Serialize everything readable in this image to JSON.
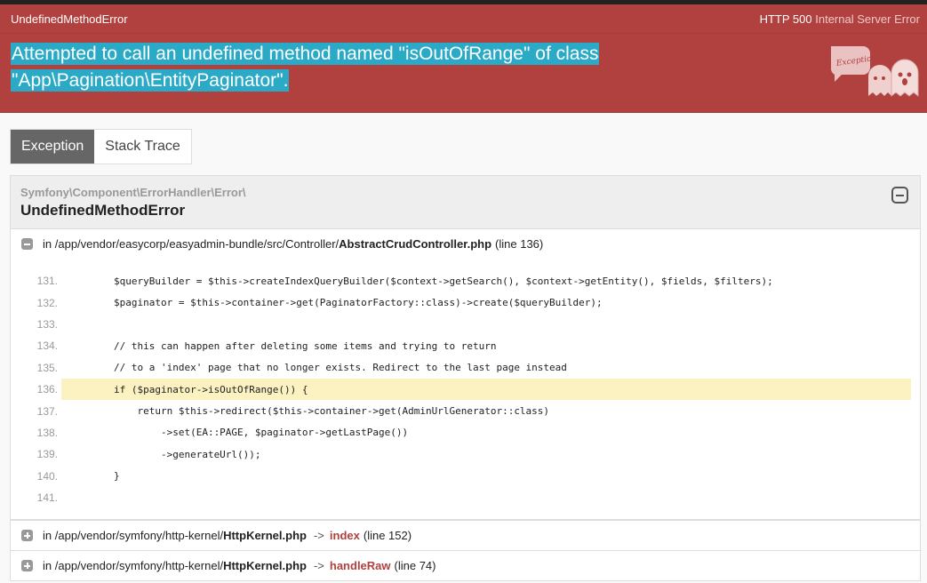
{
  "header": {
    "exception_name": "UndefinedMethodError",
    "status_code": "HTTP 500",
    "status_text": "Internal Server Error"
  },
  "hero": {
    "message_line1": "Attempted to call an undefined method named \"isOutOfRange\" of class",
    "message_line2": "\"App\\Pagination\\EntityPaginator\"."
  },
  "tabs": [
    {
      "label": "Exception",
      "active": true
    },
    {
      "label": "Stack Trace",
      "active": false
    }
  ],
  "exception": {
    "namespace": "Symfony\\Component\\ErrorHandler\\Error\\",
    "class": "UndefinedMethodError"
  },
  "frames": [
    {
      "prefix": "in",
      "path": "/app/vendor/easycorp/easyadmin-bundle/src/Controller/",
      "file": "AbstractCrudController.php",
      "line_info": "(line 136)",
      "expanded": true
    },
    {
      "prefix": "in",
      "path": "/app/vendor/symfony/http-kernel/",
      "file": "HttpKernel.php",
      "arrow": "->",
      "function": "index",
      "line_info": "(line 152)",
      "expanded": false
    },
    {
      "prefix": "in",
      "path": "/app/vendor/symfony/http-kernel/",
      "file": "HttpKernel.php",
      "arrow": "->",
      "function": "handleRaw",
      "line_info": "(line 74)",
      "expanded": false
    }
  ],
  "code": [
    {
      "no": "131.",
      "text": "        $queryBuilder = $this->createIndexQueryBuilder($context->getSearch(), $context->getEntity(), $fields, $filters);"
    },
    {
      "no": "132.",
      "text": "        $paginator = $this->container->get(PaginatorFactory::class)->create($queryBuilder);"
    },
    {
      "no": "133.",
      "text": ""
    },
    {
      "no": "134.",
      "text": "        // this can happen after deleting some items and trying to return"
    },
    {
      "no": "135.",
      "text": "        // to a 'index' page that no longer exists. Redirect to the last page instead"
    },
    {
      "no": "136.",
      "text": "        if ($paginator->isOutOfRange()) {",
      "highlight": true
    },
    {
      "no": "137.",
      "text": "            return $this->redirect($this->container->get(AdminUrlGenerator::class)"
    },
    {
      "no": "138.",
      "text": "                ->set(EA::PAGE, $paginator->getLastPage())"
    },
    {
      "no": "139.",
      "text": "                ->generateUrl());"
    },
    {
      "no": "140.",
      "text": "        }"
    },
    {
      "no": "141.",
      "text": ""
    }
  ]
}
